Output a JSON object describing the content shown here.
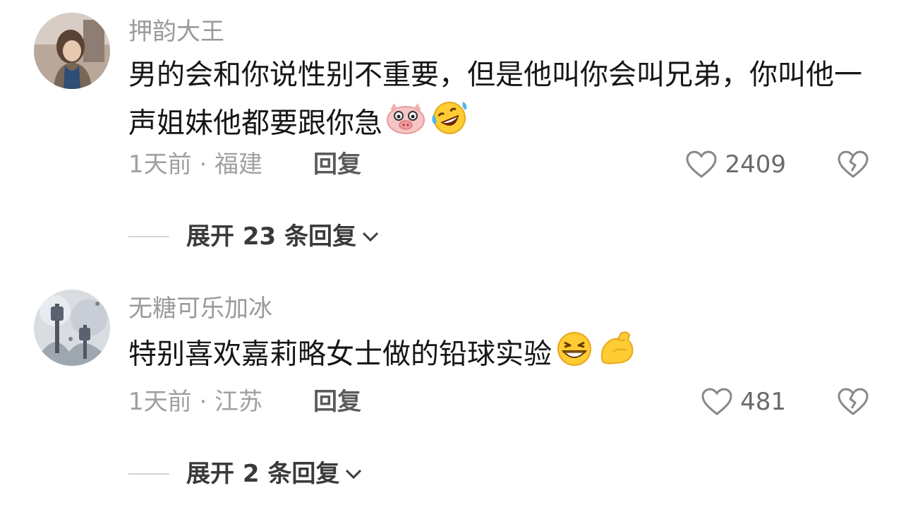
{
  "comments": [
    {
      "username": "押韵大王",
      "text": "男的会和你说性别不重要，但是他叫你会叫兄弟，你叫他一声姐妹他都要跟你急",
      "emojis": [
        "pig-face-icon",
        "rolling-laughing-icon"
      ],
      "time_location": "1天前 · 福建",
      "reply_label": "回复",
      "like_count": "2409",
      "expand_label": "展开 23 条回复"
    },
    {
      "username": "无糖可乐加冰",
      "text": "特别喜欢嘉莉略女士做的铅球实验",
      "emojis": [
        "grinning-squinting-icon",
        "flexed-biceps-icon"
      ],
      "time_location": "1天前 · 江苏",
      "reply_label": "回复",
      "like_count": "481",
      "expand_label": "展开 2 条回复"
    }
  ],
  "icons": {
    "like": "heart-outline-icon",
    "dislike": "broken-heart-icon",
    "expand": "chevron-down-icon"
  }
}
